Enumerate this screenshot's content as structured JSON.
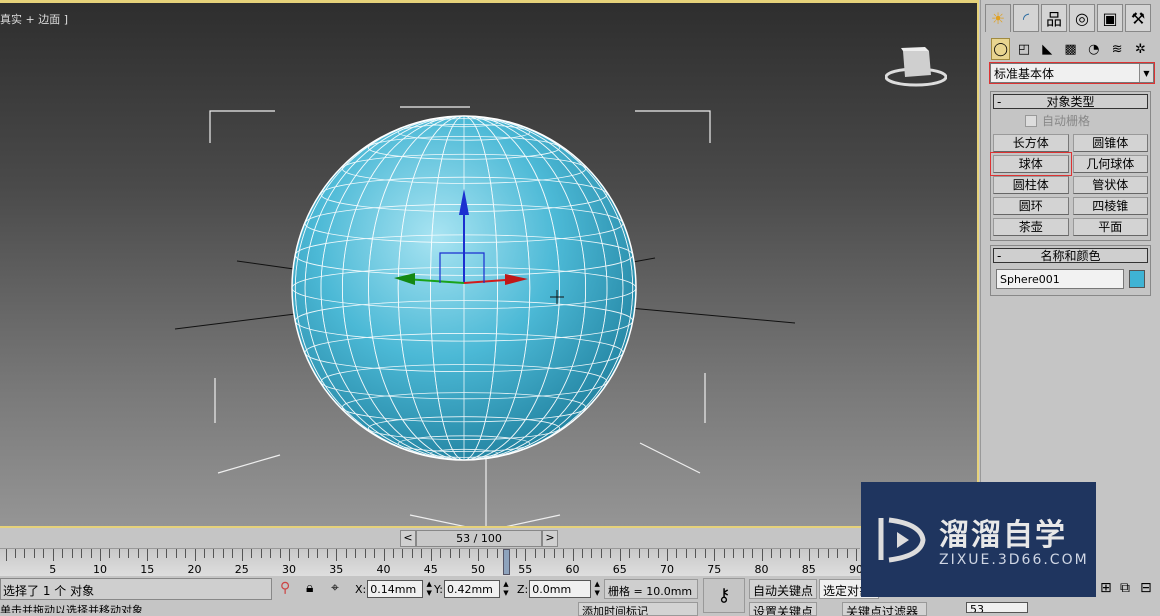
{
  "viewport": {
    "label": "真实 + 边面 ]",
    "object_color": "#3fb3d4",
    "border_color": "#e6d27a"
  },
  "command_panel": {
    "tabs": [
      {
        "name": "create",
        "icon": "sun-icon",
        "active": true
      },
      {
        "name": "modify",
        "icon": "modify-icon"
      },
      {
        "name": "hierarchy",
        "icon": "hierarchy-icon"
      },
      {
        "name": "motion",
        "icon": "motion-icon"
      },
      {
        "name": "display",
        "icon": "display-icon"
      },
      {
        "name": "utilities",
        "icon": "hammer-icon"
      }
    ],
    "subcategories": [
      "geometry",
      "shapes",
      "lights",
      "cameras",
      "helpers",
      "space-warps",
      "systems"
    ],
    "category_dropdown": "标准基本体",
    "object_type": {
      "title": "对象类型",
      "autogrid_label": "自动栅格",
      "buttons": [
        "长方体",
        "圆锥体",
        "球体",
        "几何球体",
        "圆柱体",
        "管状体",
        "圆环",
        "四棱锥",
        "茶壶",
        "平面"
      ]
    },
    "name_color": {
      "title": "名称和颜色",
      "name_value": "Sphere001",
      "color": "#3fb3d4"
    }
  },
  "timeline": {
    "slider_label": "53 / 100",
    "prev": "<",
    "next": ">",
    "current_frame": 53,
    "total_frames": 100,
    "tick_labels": [
      "5",
      "10",
      "15",
      "20",
      "25",
      "30",
      "35",
      "40",
      "45",
      "50",
      "55",
      "60",
      "65",
      "70",
      "75",
      "80",
      "85",
      "90"
    ]
  },
  "status": {
    "selection": "选择了 1 个 对象",
    "prompt": "单击并拖动以选择并移动对象",
    "x_label": "X:",
    "x_value": "0.14mm",
    "y_label": "Y:",
    "y_value": "0.42mm",
    "z_label": "Z:",
    "z_value": "0.0mm",
    "grid": "栅格 = 10.0mm",
    "auto_key": "自动关键点",
    "set_key": "设置关键点",
    "selected_dropdown": "选定对象",
    "key_filters": "关键点过滤器",
    "add_time_tag": "添加时间标记",
    "frame_field": "53"
  },
  "watermark": {
    "title": "溜溜自学",
    "url": "ZIXUE.3D66.COM",
    "bg": "#1f355f"
  }
}
